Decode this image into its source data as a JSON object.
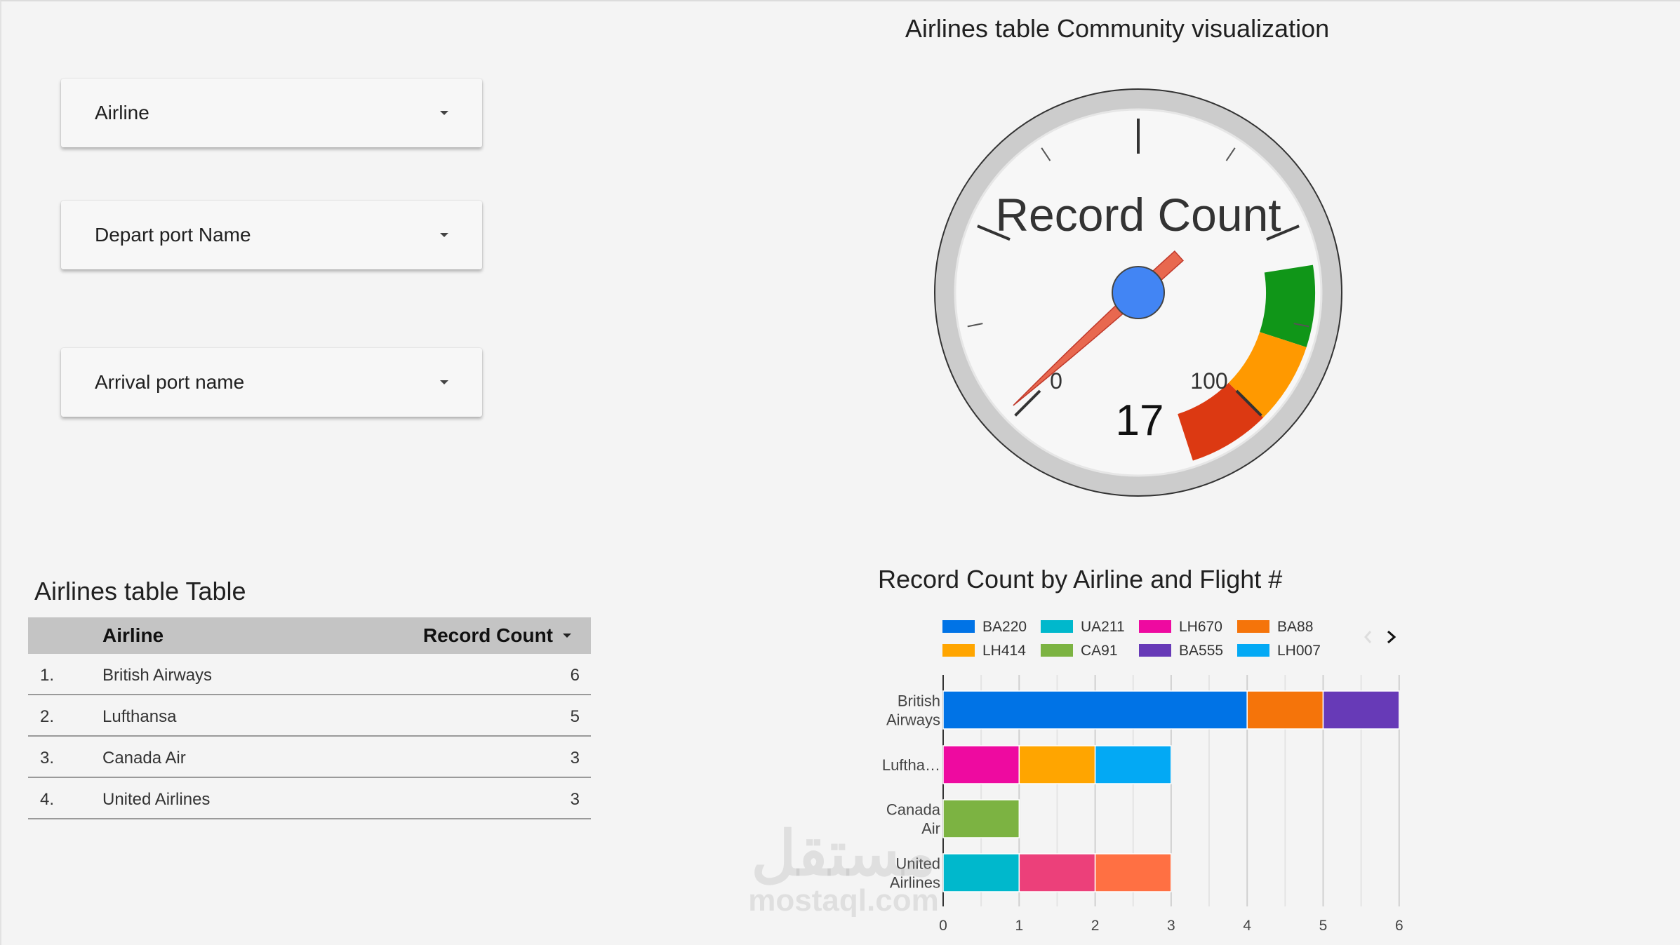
{
  "filters": [
    {
      "label": "Airline"
    },
    {
      "label": "Depart port Name"
    },
    {
      "label": "Arrival port name"
    }
  ],
  "gauge": {
    "title": "Airlines table Community visualization",
    "label": "Record Count",
    "value": 17,
    "min_label": "0",
    "max_label": "100",
    "min": 0,
    "max": 100,
    "colors": {
      "green": "#109618",
      "orange": "#ff9900",
      "red": "#dc3912",
      "needle": "#e8684f",
      "hub": "#4285f4"
    }
  },
  "table": {
    "title": "Airlines table Table",
    "headers": {
      "airline": "Airline",
      "count": "Record Count"
    },
    "rows": [
      {
        "idx": "1.",
        "airline": "British Airways",
        "count": "6"
      },
      {
        "idx": "2.",
        "airline": "Lufthansa",
        "count": "5"
      },
      {
        "idx": "3.",
        "airline": "Canada Air",
        "count": "3"
      },
      {
        "idx": "4.",
        "airline": "United Airlines",
        "count": "3"
      }
    ]
  },
  "chart_data": {
    "type": "bar",
    "orientation": "horizontal",
    "stacked": true,
    "title": "Record Count by Airline and Flight #",
    "categories": [
      [
        "British",
        "Airways"
      ],
      [
        "Luftha…"
      ],
      [
        "Canada",
        "Air"
      ],
      [
        "United",
        "Airlines"
      ]
    ],
    "x_ticks": [
      0,
      1,
      2,
      3,
      4,
      5,
      6
    ],
    "xlim": [
      0,
      6
    ],
    "legend_position": "top",
    "series": [
      {
        "name": "BA220",
        "color": "#0073e6",
        "values": [
          4,
          0,
          0,
          0
        ]
      },
      {
        "name": "UA211",
        "color": "#00b8cc",
        "values": [
          0,
          0,
          0,
          1
        ]
      },
      {
        "name": "LH670",
        "color": "#ee0aa0",
        "values": [
          0,
          1,
          0,
          0
        ]
      },
      {
        "name": "BA88",
        "color": "#f5740a",
        "values": [
          1,
          0,
          0,
          0
        ]
      },
      {
        "name": "LH414",
        "color": "#ffa500",
        "values": [
          0,
          1,
          0,
          0
        ]
      },
      {
        "name": "CA91",
        "color": "#7cb342",
        "values": [
          0,
          0,
          1,
          0
        ]
      },
      {
        "name": "BA555",
        "color": "#673ab7",
        "values": [
          1,
          0,
          0,
          0
        ]
      },
      {
        "name": "LH007",
        "color": "#03a9f4",
        "values": [
          0,
          1,
          0,
          0
        ]
      },
      {
        "name": "",
        "color": "#ec407a",
        "values": [
          0,
          0,
          0,
          1
        ]
      },
      {
        "name": "",
        "color": "#ff7043",
        "values": [
          0,
          0,
          0,
          1
        ]
      }
    ]
  },
  "watermark": {
    "arabic": "مستقل",
    "latin": "mostaql.com"
  }
}
